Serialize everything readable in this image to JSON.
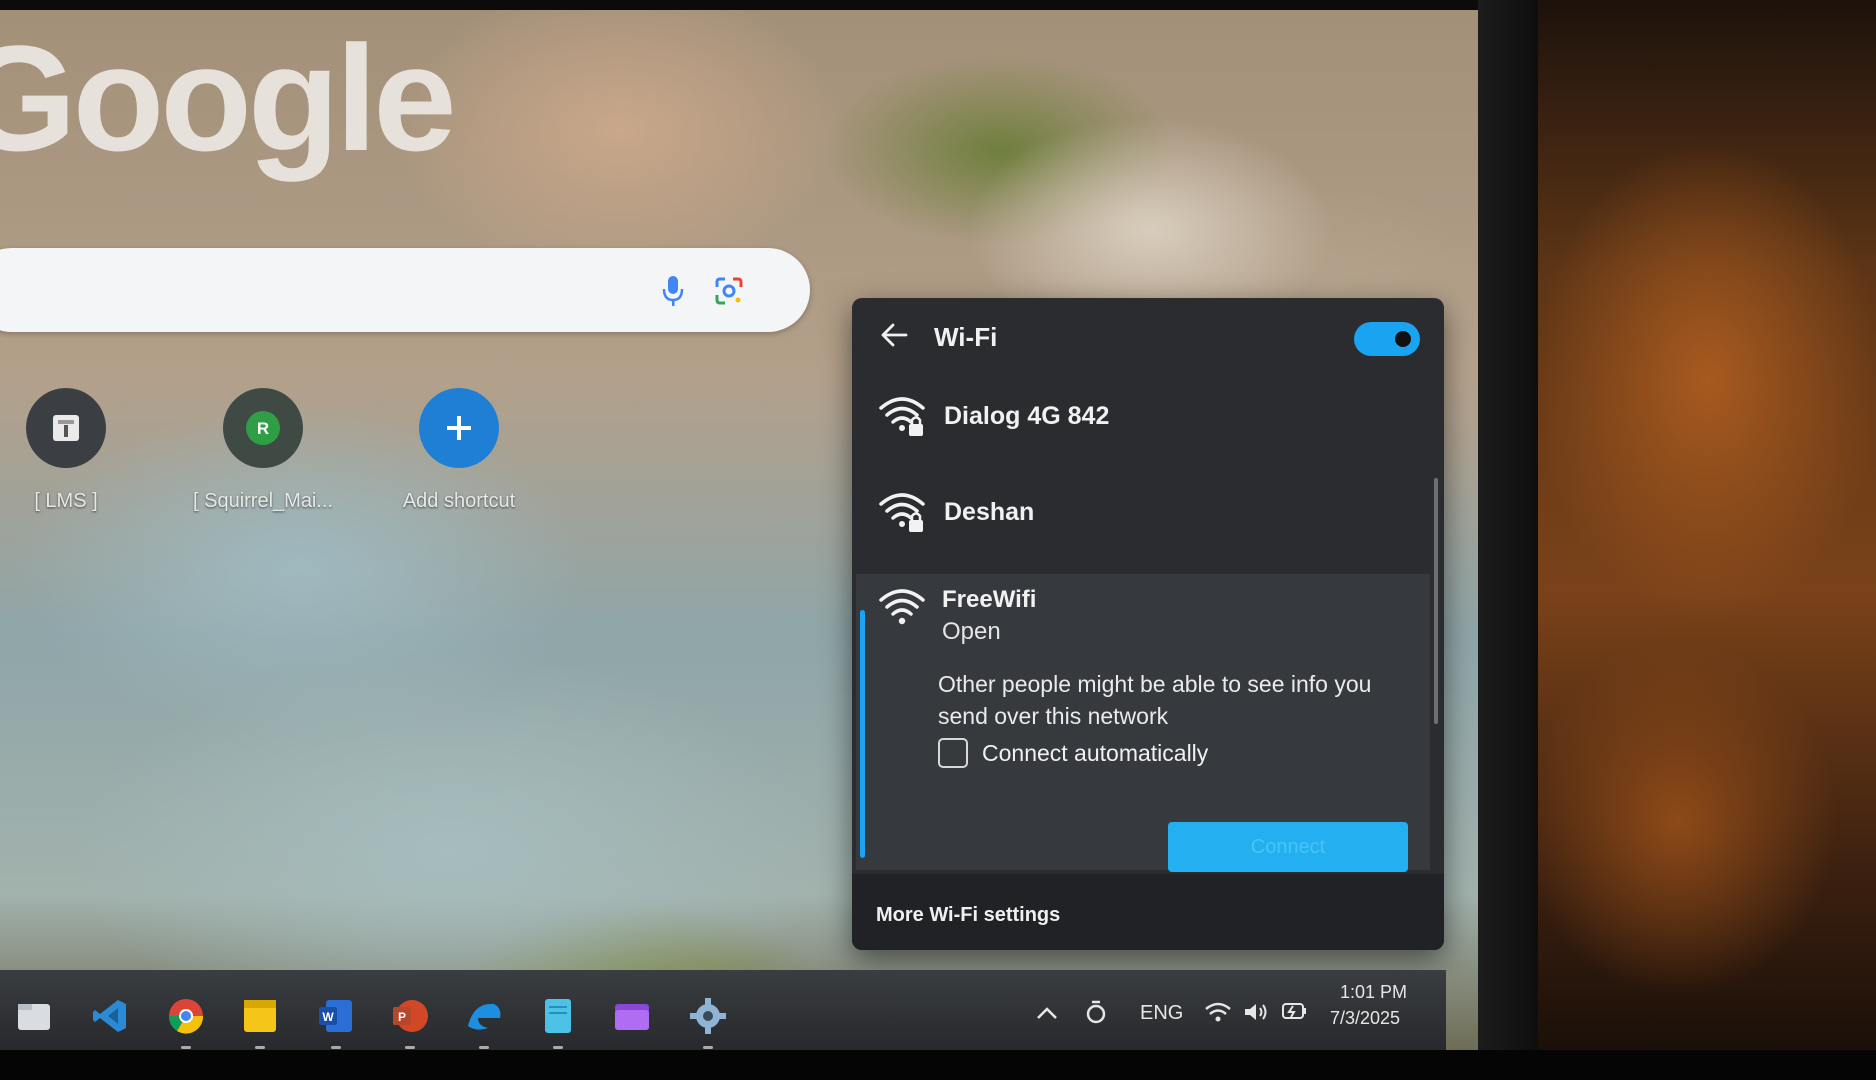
{
  "google": {
    "logo_text": "Google"
  },
  "shortcuts": [
    {
      "label": "[ LMS ]",
      "icon": "lms-icon"
    },
    {
      "label": "[ Squirrel_Mai...",
      "icon": "avatar-r",
      "avatar_letter": "R"
    },
    {
      "label": "Add shortcut",
      "icon": "plus-icon"
    }
  ],
  "wifi": {
    "title": "Wi-Fi",
    "toggle_on": true,
    "networks": [
      {
        "name": "Dialog 4G 842",
        "secured": true
      },
      {
        "name": "Deshan",
        "secured": true
      }
    ],
    "selected": {
      "name": "FreeWifi",
      "status": "Open",
      "warning": "Other people might be able to see info you send over this network",
      "connect_automatically_label": "Connect automatically",
      "connect_automatically_checked": false,
      "connect_button_label": "Connect"
    },
    "footer_link": "More Wi-Fi settings"
  },
  "taskbar": {
    "apps": [
      "file-explorer-icon",
      "vscode-icon",
      "chrome-icon",
      "sticky-notes-icon",
      "word-icon",
      "powerpoint-icon",
      "edge-icon",
      "notepad-icon",
      "files-icon",
      "settings-icon"
    ],
    "tray": {
      "language": "ENG",
      "time": "1:01 PM",
      "date": "7/3/2025"
    }
  },
  "colors": {
    "accent": "#1aa3f0",
    "flyout_bg": "#2a2c30",
    "flyout_selected_bg": "#363a3f"
  }
}
